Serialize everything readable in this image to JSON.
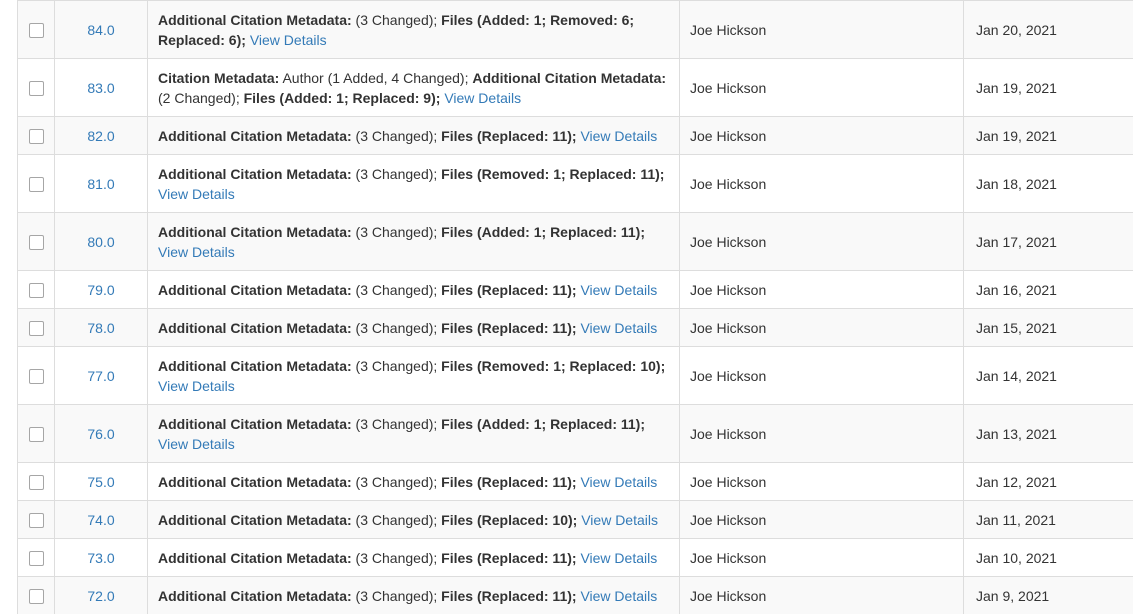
{
  "rows": [
    {
      "version": "84.0",
      "contributor": "Joe Hickson",
      "date": "Jan 20, 2021",
      "summary": [
        {
          "b": "Additional Citation Metadata:"
        },
        {
          "t": " (3 Changed); "
        },
        {
          "b": "Files (Added: 1; Removed: 6; Replaced: 6);"
        },
        {
          "t": " "
        },
        {
          "a": "View Details"
        }
      ]
    },
    {
      "version": "83.0",
      "contributor": "Joe Hickson",
      "date": "Jan 19, 2021",
      "summary": [
        {
          "b": "Citation Metadata:"
        },
        {
          "t": " Author (1 Added, 4 Changed); "
        },
        {
          "b": "Additional Citation Metadata:"
        },
        {
          "t": " (2 Changed); "
        },
        {
          "b": "Files (Added: 1; Replaced: 9);"
        },
        {
          "t": " "
        },
        {
          "a": "View Details"
        }
      ]
    },
    {
      "version": "82.0",
      "contributor": "Joe Hickson",
      "date": "Jan 19, 2021",
      "summary": [
        {
          "b": "Additional Citation Metadata:"
        },
        {
          "t": " (3 Changed); "
        },
        {
          "b": "Files (Replaced: 11);"
        },
        {
          "t": " "
        },
        {
          "a": "View Details"
        }
      ]
    },
    {
      "version": "81.0",
      "contributor": "Joe Hickson",
      "date": "Jan 18, 2021",
      "summary": [
        {
          "b": "Additional Citation Metadata:"
        },
        {
          "t": " (3 Changed); "
        },
        {
          "b": "Files (Removed: 1; Replaced: 11);"
        },
        {
          "t": " "
        },
        {
          "a": "View Details"
        }
      ]
    },
    {
      "version": "80.0",
      "contributor": "Joe Hickson",
      "date": "Jan 17, 2021",
      "summary": [
        {
          "b": "Additional Citation Metadata:"
        },
        {
          "t": " (3 Changed); "
        },
        {
          "b": "Files (Added: 1; Replaced: 11);"
        },
        {
          "t": " "
        },
        {
          "a": "View Details"
        }
      ]
    },
    {
      "version": "79.0",
      "contributor": "Joe Hickson",
      "date": "Jan 16, 2021",
      "summary": [
        {
          "b": "Additional Citation Metadata:"
        },
        {
          "t": " (3 Changed); "
        },
        {
          "b": "Files (Replaced: 11);"
        },
        {
          "t": " "
        },
        {
          "a": "View Details"
        }
      ]
    },
    {
      "version": "78.0",
      "contributor": "Joe Hickson",
      "date": "Jan 15, 2021",
      "summary": [
        {
          "b": "Additional Citation Metadata:"
        },
        {
          "t": " (3 Changed); "
        },
        {
          "b": "Files (Replaced: 11);"
        },
        {
          "t": " "
        },
        {
          "a": "View Details"
        }
      ]
    },
    {
      "version": "77.0",
      "contributor": "Joe Hickson",
      "date": "Jan 14, 2021",
      "summary": [
        {
          "b": "Additional Citation Metadata:"
        },
        {
          "t": " (3 Changed); "
        },
        {
          "b": "Files (Removed: 1; Replaced: 10);"
        },
        {
          "t": " "
        },
        {
          "a": "View Details"
        }
      ]
    },
    {
      "version": "76.0",
      "contributor": "Joe Hickson",
      "date": "Jan 13, 2021",
      "summary": [
        {
          "b": "Additional Citation Metadata:"
        },
        {
          "t": " (3 Changed); "
        },
        {
          "b": "Files (Added: 1; Replaced: 11);"
        },
        {
          "t": " "
        },
        {
          "a": "View Details"
        }
      ]
    },
    {
      "version": "75.0",
      "contributor": "Joe Hickson",
      "date": "Jan 12, 2021",
      "summary": [
        {
          "b": "Additional Citation Metadata:"
        },
        {
          "t": " (3 Changed); "
        },
        {
          "b": "Files (Replaced: 11);"
        },
        {
          "t": " "
        },
        {
          "a": "View Details"
        }
      ]
    },
    {
      "version": "74.0",
      "contributor": "Joe Hickson",
      "date": "Jan 11, 2021",
      "summary": [
        {
          "b": "Additional Citation Metadata:"
        },
        {
          "t": " (3 Changed); "
        },
        {
          "b": "Files (Replaced: 10);"
        },
        {
          "t": " "
        },
        {
          "a": "View Details"
        }
      ]
    },
    {
      "version": "73.0",
      "contributor": "Joe Hickson",
      "date": "Jan 10, 2021",
      "summary": [
        {
          "b": "Additional Citation Metadata:"
        },
        {
          "t": " (3 Changed); "
        },
        {
          "b": "Files (Replaced: 11);"
        },
        {
          "t": " "
        },
        {
          "a": "View Details"
        }
      ]
    },
    {
      "version": "72.0",
      "contributor": "Joe Hickson",
      "date": "Jan 9, 2021",
      "summary": [
        {
          "b": "Additional Citation Metadata:"
        },
        {
          "t": " (3 Changed); "
        },
        {
          "b": "Files (Replaced: 11);"
        },
        {
          "t": " "
        },
        {
          "a": "View Details"
        }
      ]
    }
  ]
}
